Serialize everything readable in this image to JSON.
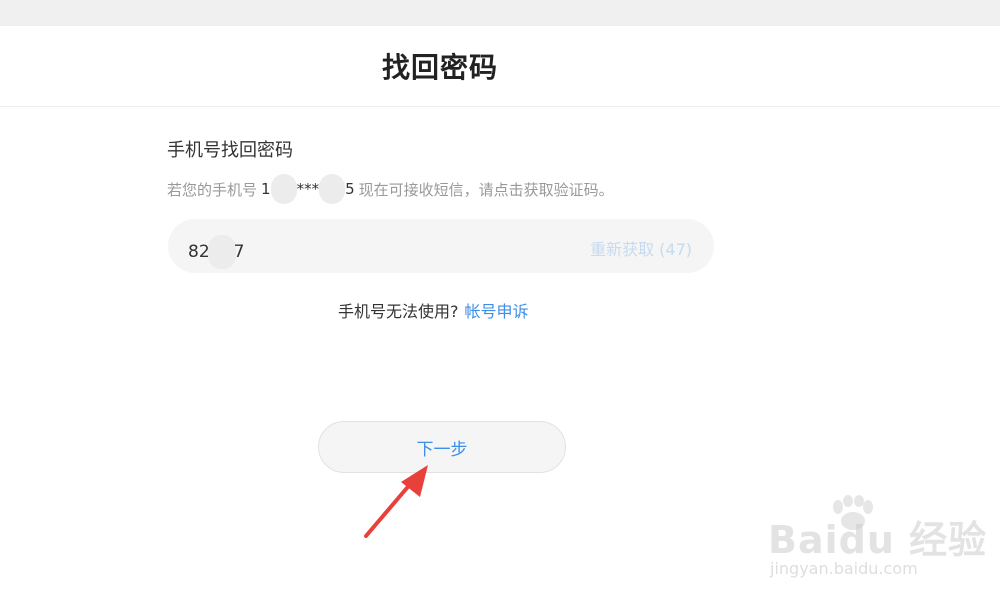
{
  "header": {
    "title": "找回密码"
  },
  "form": {
    "section_title": "手机号找回密码",
    "hint_prefix": "若您的手机号",
    "phone_mask_start": "1",
    "phone_mask_middle": "***",
    "phone_mask_end": "5",
    "hint_suffix": "现在可接收短信，请点击获取验证码。",
    "code_value_start": "82",
    "code_value_end": "7",
    "resend_label": "重新获取 (47)"
  },
  "help": {
    "question": "手机号无法使用?",
    "appeal_link": "帐号申诉"
  },
  "actions": {
    "next_label": "下一步"
  },
  "watermark": {
    "logo": "Baidu 经验",
    "url": "jingyan.baidu.com"
  },
  "colors": {
    "accent": "#3c8ee7",
    "arrow": "#e8403a",
    "resend_disabled": "#c6daf0"
  }
}
